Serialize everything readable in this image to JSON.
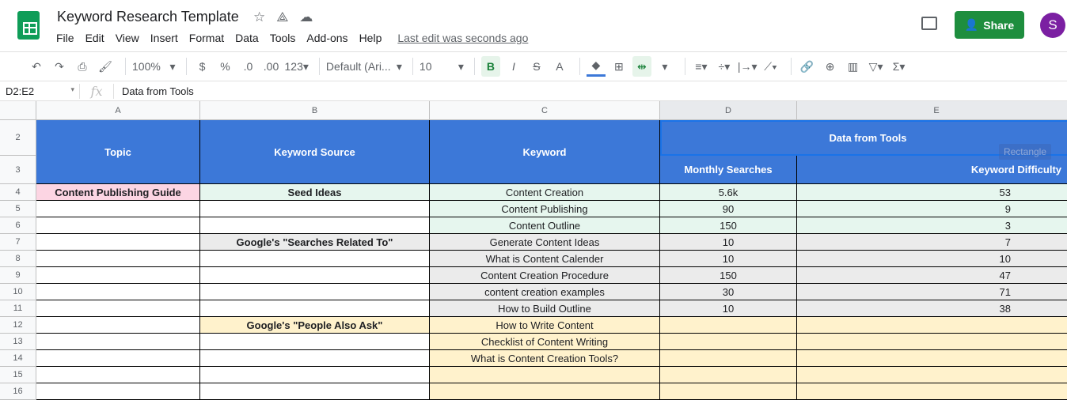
{
  "app": {
    "title": "Keyword Research Template",
    "menu": [
      "File",
      "Edit",
      "View",
      "Insert",
      "Format",
      "Data",
      "Tools",
      "Add-ons",
      "Help"
    ],
    "last_edit": "Last edit was seconds ago",
    "share": "Share",
    "avatar": "S"
  },
  "toolbar": {
    "zoom": "100%",
    "currency": "$",
    "percent": "%",
    "dec_decrease": ".0",
    "dec_increase": ".00",
    "format_more": "123",
    "font": "Default (Ari...",
    "size": "10",
    "bold": "B",
    "italic": "I",
    "strike": "S",
    "text_color": "A"
  },
  "formula_bar": {
    "name_box": "D2:E2",
    "fx": "fx",
    "content": "Data from Tools"
  },
  "columns": [
    "A",
    "B",
    "C",
    "D",
    "E"
  ],
  "headers": {
    "topic": "Topic",
    "source": "Keyword Source",
    "keyword": "Keyword",
    "group": "Data from Tools",
    "searches": "Monthly Searches",
    "difficulty": "Keyword Difficulty"
  },
  "overlay": "Rectangle",
  "row_numbers": [
    "2",
    "3",
    "4",
    "5",
    "6",
    "7",
    "8",
    "9",
    "10",
    "11",
    "12",
    "13",
    "14",
    "15",
    "16"
  ],
  "rows": [
    {
      "n": "4",
      "topic": "Content Publishing Guide",
      "source": "Seed Ideas",
      "keyword": "Content Creation",
      "searches": "5.6k",
      "difficulty": "53"
    },
    {
      "n": "5",
      "topic": "",
      "source": "",
      "keyword": "Content Publishing",
      "searches": "90",
      "difficulty": "9"
    },
    {
      "n": "6",
      "topic": "",
      "source": "",
      "keyword": "Content Outline",
      "searches": "150",
      "difficulty": "3"
    },
    {
      "n": "7",
      "topic": "",
      "source": "Google's \"Searches Related To\"",
      "keyword": "Generate Content Ideas",
      "searches": "10",
      "difficulty": "7"
    },
    {
      "n": "8",
      "topic": "",
      "source": "",
      "keyword": "What is Content Calender",
      "searches": "10",
      "difficulty": "10"
    },
    {
      "n": "9",
      "topic": "",
      "source": "",
      "keyword": "Content Creation Procedure",
      "searches": "150",
      "difficulty": "47"
    },
    {
      "n": "10",
      "topic": "",
      "source": "",
      "keyword": "content creation examples",
      "searches": "30",
      "difficulty": "71"
    },
    {
      "n": "11",
      "topic": "",
      "source": "",
      "keyword": "How to Build Outline",
      "searches": "10",
      "difficulty": "38"
    },
    {
      "n": "12",
      "topic": "",
      "source": "Google's \"People Also Ask\"",
      "keyword": "How to Write Content",
      "searches": "",
      "difficulty": ""
    },
    {
      "n": "13",
      "topic": "",
      "source": "",
      "keyword": "Checklist of Content Writing",
      "searches": "",
      "difficulty": ""
    },
    {
      "n": "14",
      "topic": "",
      "source": "",
      "keyword": "What is Content Creation Tools?",
      "searches": "",
      "difficulty": ""
    },
    {
      "n": "15",
      "topic": "",
      "source": "",
      "keyword": "",
      "searches": "",
      "difficulty": ""
    },
    {
      "n": "16",
      "topic": "",
      "source": "",
      "keyword": "",
      "searches": "",
      "difficulty": ""
    }
  ],
  "colors": {
    "header": "#3c78d8",
    "pink": "#fcd5e3",
    "green": "#e6f6ee",
    "grey": "#ebebeb",
    "yellow": "#fff2cc",
    "accent": "#1e8e3e"
  }
}
